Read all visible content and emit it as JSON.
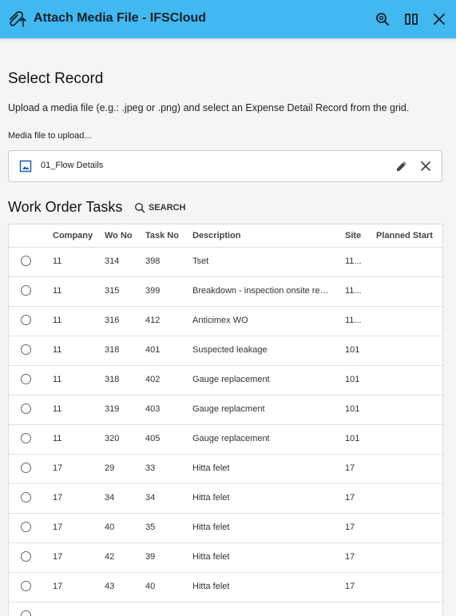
{
  "window": {
    "title": "Attach Media File - IFSCloud",
    "icons": [
      "attach-icon",
      "zoom-search-icon",
      "split-view-icon",
      "close-icon"
    ]
  },
  "section": {
    "title": "Select Record",
    "instructions": "Upload a media file (e.g.: .jpeg or .png) and select an Expense Detail Record from the grid."
  },
  "media": {
    "label": "Media file to upload...",
    "file_name": "01_Flow Details"
  },
  "grid": {
    "title": "Work Order Tasks",
    "search_label": "SEARCH",
    "columns": [
      "Company",
      "Wo No",
      "Task No",
      "Description",
      "Site",
      "Planned Start"
    ],
    "rows": [
      {
        "company": "11",
        "wo_no": "314",
        "task_no": "398",
        "description": "Tset",
        "site": "11...",
        "planned_start": ""
      },
      {
        "company": "11",
        "wo_no": "315",
        "task_no": "399",
        "description": "Breakdown - inspection onsite req...",
        "site": "11...",
        "planned_start": ""
      },
      {
        "company": "11",
        "wo_no": "316",
        "task_no": "412",
        "description": "Anticimex WO",
        "site": "11...",
        "planned_start": ""
      },
      {
        "company": "11",
        "wo_no": "318",
        "task_no": "401",
        "description": "Suspected leakage",
        "site": "101",
        "planned_start": ""
      },
      {
        "company": "11",
        "wo_no": "318",
        "task_no": "402",
        "description": "Gauge replacement",
        "site": "101",
        "planned_start": ""
      },
      {
        "company": "11",
        "wo_no": "319",
        "task_no": "403",
        "description": "Gauge replacment",
        "site": "101",
        "planned_start": ""
      },
      {
        "company": "11",
        "wo_no": "320",
        "task_no": "405",
        "description": "Gauge replacement",
        "site": "101",
        "planned_start": ""
      },
      {
        "company": "17",
        "wo_no": "29",
        "task_no": "33",
        "description": "Hitta felet",
        "site": "17",
        "planned_start": ""
      },
      {
        "company": "17",
        "wo_no": "34",
        "task_no": "34",
        "description": "Hitta felet",
        "site": "17",
        "planned_start": ""
      },
      {
        "company": "17",
        "wo_no": "40",
        "task_no": "35",
        "description": "Hitta felet",
        "site": "17",
        "planned_start": ""
      },
      {
        "company": "17",
        "wo_no": "42",
        "task_no": "39",
        "description": "Hitta felet",
        "site": "17",
        "planned_start": ""
      },
      {
        "company": "17",
        "wo_no": "43",
        "task_no": "40",
        "description": "Hitta felet",
        "site": "17",
        "planned_start": ""
      }
    ]
  },
  "colors": {
    "header_bg": "#42b8f0",
    "page_bg": "#f5f5f5",
    "accent": "#1e5fb3"
  }
}
